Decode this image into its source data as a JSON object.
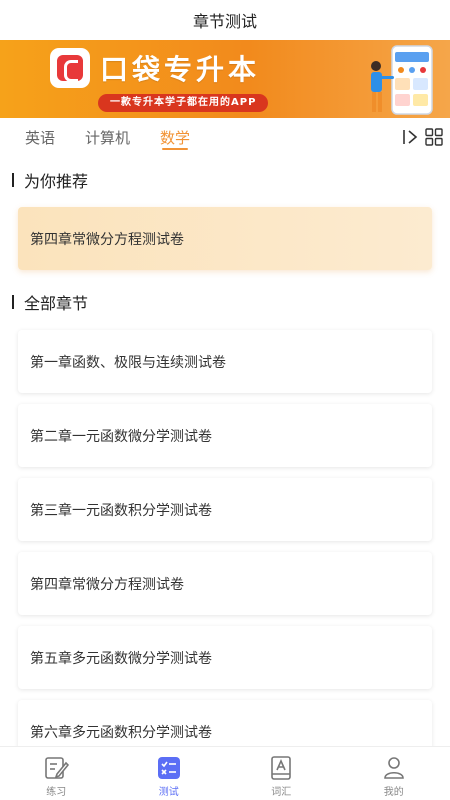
{
  "header": {
    "title": "章节测试"
  },
  "banner": {
    "brand": "口袋专升本",
    "slogan": "一款专升本学子都在用的APP",
    "accent_colors": [
      "#f6a21a",
      "#f28a1c",
      "#d9361e",
      "#e8393a"
    ]
  },
  "tabs": {
    "items": [
      {
        "label": "英语"
      },
      {
        "label": "计算机"
      },
      {
        "label": "数学"
      }
    ],
    "active": "数学",
    "active_color": "#f29335",
    "icons": [
      "scroll-right-icon",
      "grid-icon"
    ]
  },
  "recommended": {
    "title": "为你推荐",
    "items": [
      {
        "label": "第四章常微分方程测试卷"
      }
    ]
  },
  "chapters": {
    "title": "全部章节",
    "items": [
      {
        "label": "第一章函数、极限与连续测试卷"
      },
      {
        "label": "第二章一元函数微分学测试卷"
      },
      {
        "label": "第三章一元函数积分学测试卷"
      },
      {
        "label": "第四章常微分方程测试卷"
      },
      {
        "label": "第五章多元函数微分学测试卷"
      },
      {
        "label": "第六章多元函数积分学测试卷"
      }
    ]
  },
  "bottom_nav": {
    "items": [
      {
        "label": "练习",
        "icon": "pencil-icon"
      },
      {
        "label": "测试",
        "icon": "test-list-icon"
      },
      {
        "label": "词汇",
        "icon": "book-icon"
      },
      {
        "label": "我的",
        "icon": "person-icon"
      }
    ],
    "active": "测试",
    "active_color": "#5b6ef5"
  }
}
